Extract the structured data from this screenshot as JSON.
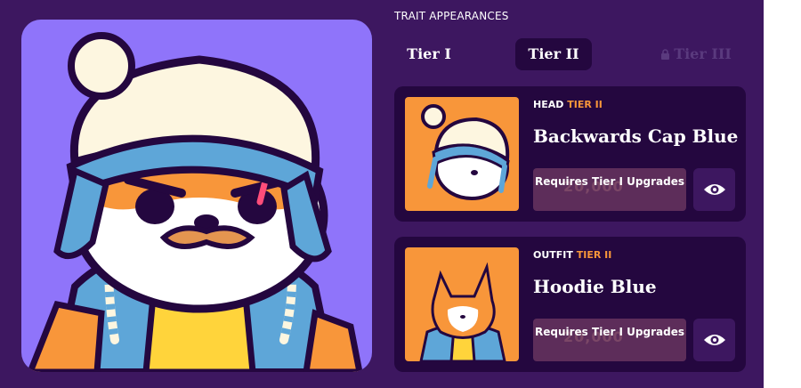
{
  "section_heading": "TRAIT APPEARANCES",
  "tabs": [
    {
      "label": "Tier I"
    },
    {
      "label": "Tier II",
      "selected": true
    },
    {
      "label": "Tier III",
      "locked": true
    }
  ],
  "traits": [
    {
      "category": "HEAD",
      "tier": "TIER II",
      "name": "Backwards Cap Blue",
      "requirement": "Requires Tier I Upgrades",
      "ghost_value": "20,000",
      "icon": "eye-icon"
    },
    {
      "category": "OUTFIT",
      "tier": "TIER II",
      "name": "Hoodie Blue",
      "requirement": "Requires Tier I Upgrades",
      "ghost_value": "20,000",
      "icon": "eye-icon"
    }
  ],
  "colors": {
    "panel": "#3d1760",
    "card": "#24073f",
    "accent": "#f8963a",
    "portrait_bg": "#8f74fa",
    "button": "#5d2d5a"
  }
}
